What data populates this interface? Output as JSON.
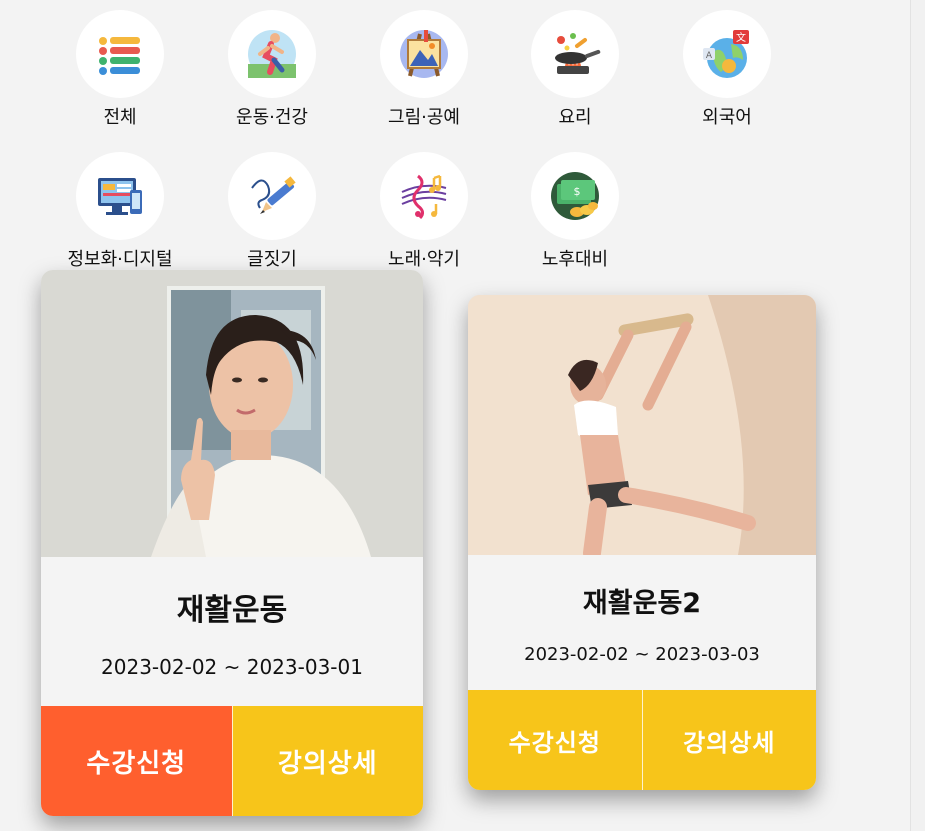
{
  "categories": [
    {
      "label": "전체",
      "icon": "list-icon"
    },
    {
      "label": "운동·건강",
      "icon": "runner-icon"
    },
    {
      "label": "그림·공예",
      "icon": "easel-icon"
    },
    {
      "label": "요리",
      "icon": "frying-pan-icon"
    },
    {
      "label": "외국어",
      "icon": "globe-translate-icon"
    },
    {
      "label": "정보화·디지털",
      "icon": "computer-icon"
    },
    {
      "label": "글짓기",
      "icon": "pen-icon"
    },
    {
      "label": "노래·악기",
      "icon": "music-note-icon"
    },
    {
      "label": "노후대비",
      "icon": "money-icon"
    }
  ],
  "courses": [
    {
      "title": "재활운동",
      "date_range": "2023-02-02 ~ 2023-03-01",
      "apply_label": "수강신청",
      "detail_label": "강의상세"
    },
    {
      "title": "재활운동2",
      "date_range": "2023-02-02 ~ 2023-03-03",
      "apply_label": "수강신청",
      "detail_label": "강의상세"
    }
  ],
  "colors": {
    "apply_active": "#ff5f2e",
    "button_yellow": "#f7c51a",
    "background": "#f3f3f3"
  }
}
